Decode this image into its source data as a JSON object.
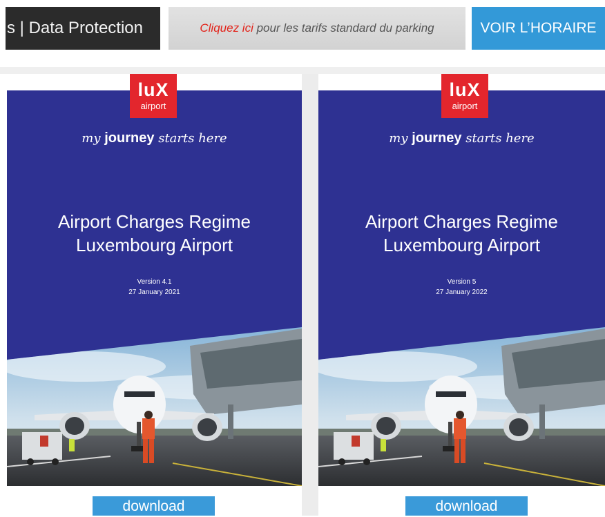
{
  "topbar": {
    "left_text": "s | Data Protection",
    "promo_link": "Cliquez ici",
    "promo_rest": " pour les tarifs standard du parking",
    "schedule_button": "VOIR L’HORAIRE"
  },
  "colors": {
    "cover_blue": "#2e3192",
    "brand_red": "#e3262d",
    "button_blue": "#3a9ad9",
    "promo_red": "#e2231a"
  },
  "documents": [
    {
      "logo_main": "luX",
      "logo_sub": "airport",
      "tagline_my": "my ",
      "tagline_journey": "journey",
      "tagline_rest": " starts here",
      "title_line1": "Airport Charges Regime",
      "title_line2": "Luxembourg Airport",
      "version": "Version 4.1",
      "date": "27 January 2021",
      "download_label": "download"
    },
    {
      "logo_main": "luX",
      "logo_sub": "airport",
      "tagline_my": "my ",
      "tagline_journey": "journey",
      "tagline_rest": " starts here",
      "title_line1": "Airport Charges Regime",
      "title_line2": "Luxembourg Airport",
      "version": "Version 5",
      "date": "27 January 2022",
      "download_label": "download"
    }
  ]
}
